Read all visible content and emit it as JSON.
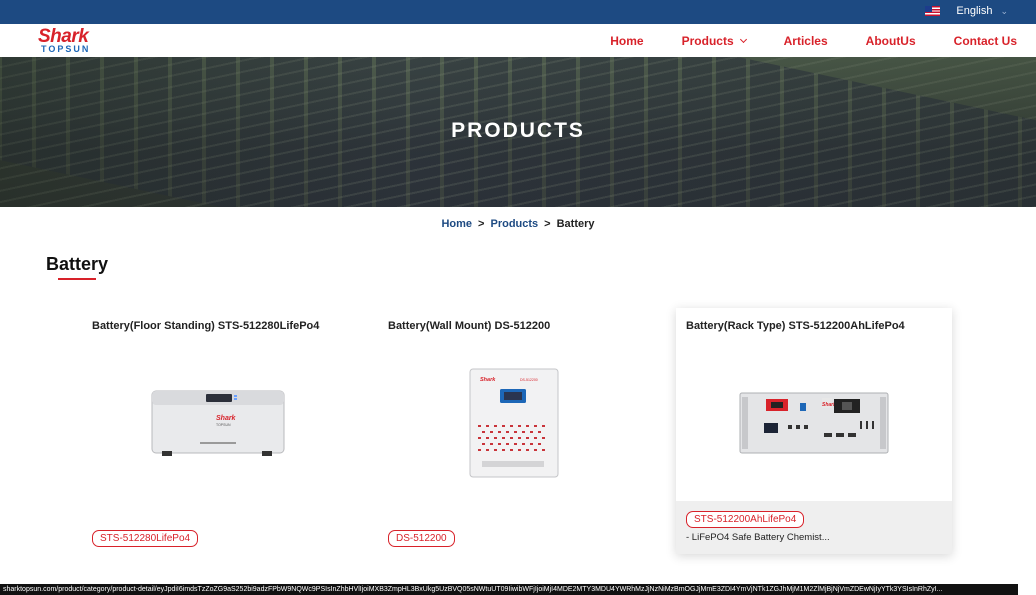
{
  "topbar": {
    "language": "English"
  },
  "logo": {
    "line1": "Shark",
    "line2": "TOPSUN"
  },
  "nav": {
    "items": [
      {
        "label": "Home"
      },
      {
        "label": "Products"
      },
      {
        "label": "Articles"
      },
      {
        "label": "AboutUs"
      },
      {
        "label": "Contact Us"
      }
    ]
  },
  "hero": {
    "title": "PRODUCTS"
  },
  "breadcrumb": {
    "home": "Home",
    "sep1": ">",
    "products": "Products",
    "sep2": ">",
    "current": "Battery"
  },
  "section": {
    "title": "Battery"
  },
  "products": [
    {
      "title": "Battery(Floor Standing) STS-512280LifePo4",
      "tag": "STS-512280LifePo4",
      "image": "floor-standing-battery"
    },
    {
      "title": "Battery(Wall Mount) DS-512200",
      "tag": "DS-512200",
      "image": "wall-mount-battery"
    },
    {
      "title": "Battery(Rack Type) STS-512200AhLifePo4",
      "tag": "STS-512200AhLifePo4",
      "desc": "- LiFePO4 Safe Battery Chemist...",
      "image": "rack-type-battery"
    }
  ],
  "status_url": "sharktopsun.com/product/category/product-detail/eyJpdiI6imdsTzZoZG9aS252bi9adzFPbW9NQWc9PSIsInZhbHVlIjoiMXB3ZmpHL3BxUkg5UzBVQ05sNWtuUT09IiwibWFjIjoiMjI4MDE2MTY3MDU4YWRhMzJjNzNiMzBmOGJjMmE3ZDI4YmVjNTk1ZGJhMjM1M2ZlMjBjNjVmZDEwNjIyYTk3YSIsInRhZyI..."
}
